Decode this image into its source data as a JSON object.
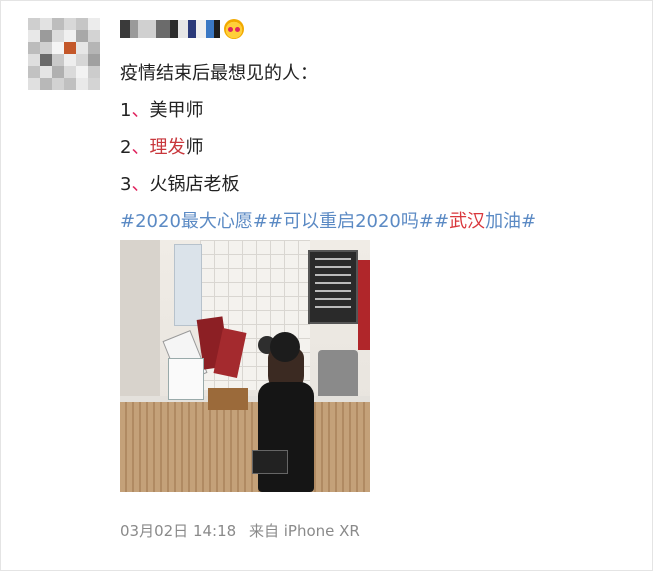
{
  "post": {
    "heading": "疫情结束后最想见的人：",
    "items": [
      {
        "num": "1",
        "sep": "、",
        "text_a": "美甲师",
        "text_b": "",
        "text_c": ""
      },
      {
        "num": "2",
        "sep": "、",
        "text_a": "",
        "text_b": "理发",
        "text_c": "师"
      },
      {
        "num": "3",
        "sep": "、",
        "text_a": "火锅店老板",
        "text_b": "",
        "text_c": ""
      }
    ],
    "hashtags": {
      "tag1": "#2020最大心愿#",
      "tag2": "#可以重启2020吗#",
      "tag3_prefix": "#",
      "tag3_red": "武汉",
      "tag3_suffix": "加油#"
    }
  },
  "meta": {
    "date": "03月02日 14:18",
    "from_label": "来自",
    "device": "iPhone XR"
  },
  "colors": {
    "hashtag": "#5b8ac4",
    "highlight": "#c8373c",
    "meta_text": "#8a8a8a"
  },
  "icons": {
    "badge": "crown-emoji-icon"
  }
}
